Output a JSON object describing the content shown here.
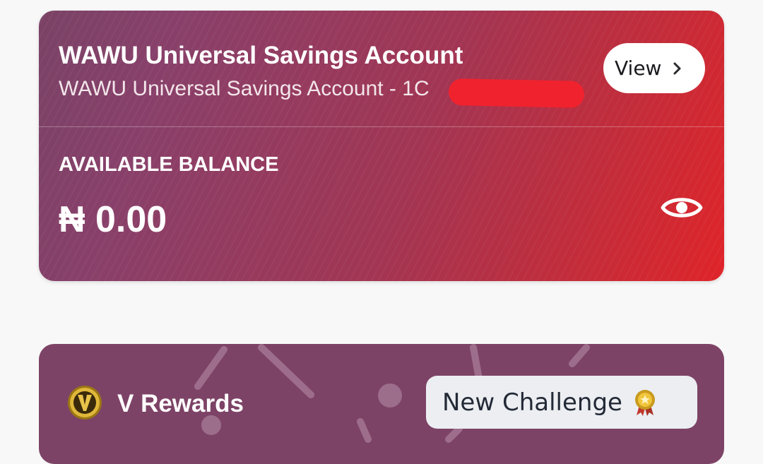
{
  "account": {
    "title": "WAWU Universal Savings Account",
    "subtitle": "WAWU Universal Savings Account - 1C",
    "view_label": "View",
    "view_icon": "chevron-right-icon",
    "balance_label": "AVAILABLE BALANCE",
    "balance_value": "₦ 0.00",
    "visibility_icon": "eye-icon",
    "gradient_colors": [
      "#7a4266",
      "#a23553",
      "#df2429"
    ]
  },
  "rewards": {
    "title": "V Rewards",
    "logo_icon": "v-coin-icon",
    "challenge_label": "New Challenge",
    "challenge_icon": "medal-icon",
    "background_color": "#7d4366"
  }
}
